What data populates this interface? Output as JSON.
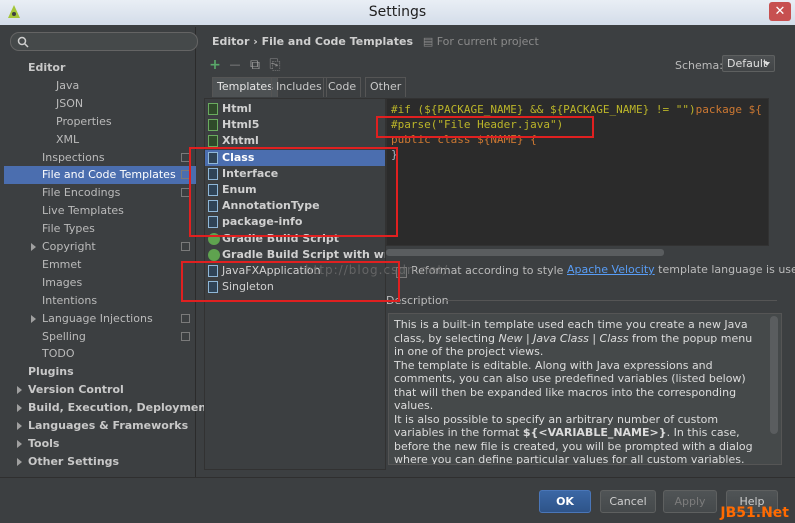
{
  "window": {
    "title": "Settings",
    "close_glyph": "✕"
  },
  "sidebar": {
    "search_placeholder": "",
    "items": [
      {
        "label": "Editor",
        "bold": true,
        "indent": 1
      },
      {
        "label": "Java",
        "indent": 3
      },
      {
        "label": "JSON",
        "indent": 3
      },
      {
        "label": "Properties",
        "indent": 3
      },
      {
        "label": "XML",
        "indent": 3
      },
      {
        "label": "Inspections",
        "indent": 2,
        "project": true
      },
      {
        "label": "File and Code Templates",
        "indent": 2,
        "project": true,
        "selected": true
      },
      {
        "label": "File Encodings",
        "indent": 2,
        "project": true
      },
      {
        "label": "Live Templates",
        "indent": 2
      },
      {
        "label": "File Types",
        "indent": 2
      },
      {
        "label": "Copyright",
        "indent": 2,
        "arrow": true,
        "project": true
      },
      {
        "label": "Emmet",
        "indent": 2
      },
      {
        "label": "Images",
        "indent": 2
      },
      {
        "label": "Intentions",
        "indent": 2
      },
      {
        "label": "Language Injections",
        "indent": 2,
        "arrow": true,
        "project": true
      },
      {
        "label": "Spelling",
        "indent": 2,
        "project": true
      },
      {
        "label": "TODO",
        "indent": 2
      },
      {
        "label": "Plugins",
        "bold": true,
        "indent": 1
      },
      {
        "label": "Version Control",
        "bold": true,
        "arrow": true,
        "indent": 1
      },
      {
        "label": "Build, Execution, Deployment",
        "bold": true,
        "arrow": true,
        "indent": 1
      },
      {
        "label": "Languages & Frameworks",
        "bold": true,
        "arrow": true,
        "indent": 1
      },
      {
        "label": "Tools",
        "bold": true,
        "arrow": true,
        "indent": 1
      },
      {
        "label": "Other Settings",
        "bold": true,
        "arrow": true,
        "indent": 1
      }
    ]
  },
  "header": {
    "breadcrumb": "Editor › File and Code Templates",
    "project_note": "For current project",
    "schema_label": "Schema:",
    "schema_value": "Default"
  },
  "toolbar": {
    "add": "+",
    "remove": "—",
    "copy": "⧉",
    "reset": "⎘"
  },
  "tabs": [
    "Templates",
    "Includes",
    "Code",
    "Other"
  ],
  "templates": [
    {
      "label": "Html",
      "icon": "green"
    },
    {
      "label": "Html5",
      "icon": "green"
    },
    {
      "label": "Xhtml",
      "icon": "green"
    },
    {
      "label": "Class",
      "icon": "blue",
      "selected": true
    },
    {
      "label": "Interface",
      "icon": "blue"
    },
    {
      "label": "Enum",
      "icon": "blue"
    },
    {
      "label": "AnnotationType",
      "icon": "blue"
    },
    {
      "label": "package-info",
      "icon": "blue"
    },
    {
      "label": "Gradle Build Script",
      "icon": "gradle"
    },
    {
      "label": "Gradle Build Script with wrapp",
      "icon": "gradle"
    },
    {
      "label": "JavaFXApplication",
      "icon": "blue",
      "plain": true
    },
    {
      "label": "Singleton",
      "icon": "blue",
      "plain": true
    }
  ],
  "editor": {
    "line1_a": "#if (${PACKAGE_NAME} && ${PACKAGE_NAME} != \"\")",
    "line1_b": "package ${",
    "line2": "#parse(\"File Header.java\")",
    "line3": "public class ${NAME} {",
    "line4": "}"
  },
  "options": {
    "reformat": "Reformat according to style",
    "velocity_link": "Apache Velocity",
    "velocity_rest": " template language is used"
  },
  "description": {
    "label": "Description",
    "p1_a": "This is a built-in template used each time you create a new Java class, by selecting ",
    "p1_i": "New | Java Class | Class",
    "p1_b": " from the popup menu in one of the project views.",
    "p2": "The template is editable. Along with Java expressions and comments, you can also use predefined variables (listed below) that will then be expanded like macros into the corresponding values.",
    "p3_a": "It is also possible to specify an arbitrary number of custom variables in the format ",
    "p3_b": "${<VARIABLE_NAME>}",
    "p3_c": ". In this case, before the new file is created, you will be prompted with a dialog where you can define particular values for all custom variables."
  },
  "buttons": {
    "ok": "OK",
    "cancel": "Cancel",
    "apply": "Apply",
    "help": "Help"
  },
  "watermark": "http://blog.csdn.net/",
  "corner_logo": "JB51.Net",
  "colors": {
    "selection": "#4b6eaf",
    "background": "#3c3f41",
    "editor_bg": "#2b2b2b",
    "highlight_box": "#e02020",
    "link": "#589df6"
  }
}
